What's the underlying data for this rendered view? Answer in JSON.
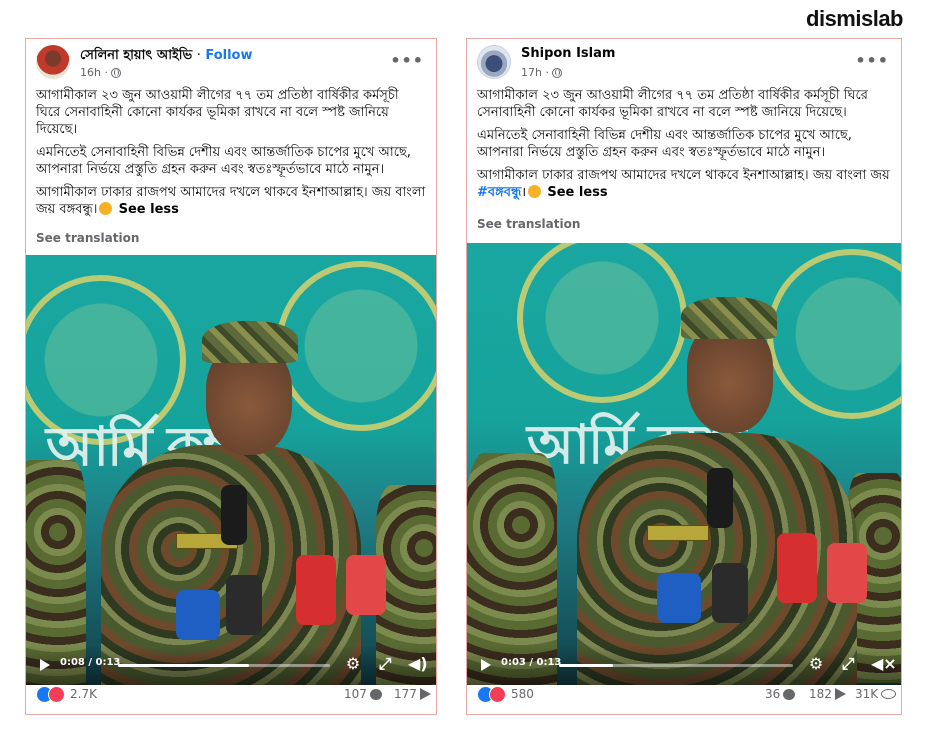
{
  "brand": "dismislab",
  "colors": {
    "link": "#1877f2",
    "card_border": "#e8a9a4",
    "muted": "#65676b"
  },
  "left_post": {
    "author": "সেলিনা হায়াৎ আইভি",
    "separator": "·",
    "follow_label": "Follow",
    "time": "16h ·",
    "more_icon": "more-icon",
    "paragraphs": [
      "আগামীকাল ২৩ জুন আওয়ামী লীগের ৭৭ তম প্রতিষ্ঠা বার্ষিকীর কর্মসূচী ঘিরে সেনাবাহিনী কোনো কার্যকর ভূমিকা রাখবে না বলে স্পষ্ট জানিয়ে দিয়েছে।",
      "এমনিতেই সেনাবাহিনী বিভিন্ন দেশীয় এবং আন্তর্জাতিক চাপের মুখে আছে, আপনারা নির্ভয়ে প্রস্তুতি গ্রহন করুন এবং স্বতঃস্ফূর্তভাবে মাঠে নামুন।"
    ],
    "last_paragraph": "আগামীকাল ঢাকার রাজপথ আমাদের দখলে থাকবে ইনশাআল্লাহ। জয় বাংলা জয় বঙ্গবন্ধু।",
    "see_less": "See less",
    "see_translation": "See translation",
    "video": {
      "current_time": "0:08",
      "duration": "0:13",
      "progress": 0.62
    },
    "reactions_count": "2.7K",
    "comments_count": "107",
    "shares_count": "177"
  },
  "right_post": {
    "author": "Shipon Islam",
    "time": "17h ·",
    "more_icon": "more-icon",
    "paragraphs": [
      "আগামীকাল ২৩ জুন আওয়ামী লীগের ৭৭ তম প্রতিষ্ঠা বার্ষিকীর কর্মসূচী ঘিরে সেনাবাহিনী কোনো কার্যকর ভূমিকা রাখবে না বলে স্পষ্ট জানিয়ে দিয়েছে।",
      "এমনিতেই সেনাবাহিনী বিভিন্ন দেশীয় এবং আন্তর্জাতিক চাপের মুখে আছে, আপনারা নির্ভয়ে প্রস্তুতি গ্রহন করুন এবং স্বতঃস্ফূর্তভাবে মাঠে নামুন।"
    ],
    "last_paragraph": "আগামীকাল ঢাকার রাজপথ আমাদের দখলে থাকবে ইনশাআল্লাহ। জয় বাংলা জয়",
    "hashtag": "#বঙ্গবন্ধু",
    "hashtag_suffix": "।",
    "see_less": "See less",
    "see_translation": "See translation",
    "video": {
      "current_time": "0:03",
      "duration": "0:13",
      "progress": 0.23
    },
    "reactions_count": "580",
    "comments_count": "36",
    "shares_count": "182",
    "views_count": "31K"
  }
}
